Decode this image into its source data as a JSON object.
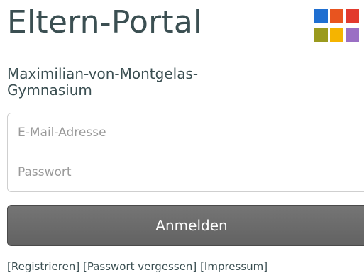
{
  "header": {
    "title": "Eltern-Portal",
    "logo": {
      "colors": [
        "#1f6fd1",
        "#e8541f",
        "#e23a2e",
        "#9a9a1e",
        "#f5b400",
        "#9a6fc4"
      ]
    }
  },
  "school": {
    "name": "Maximilian-von-Montgelas-Gymnasium"
  },
  "login_form": {
    "email": {
      "placeholder": "E-Mail-Adresse",
      "value": ""
    },
    "password": {
      "placeholder": "Passwort",
      "value": ""
    },
    "submit_label": "Anmelden"
  },
  "footer_links": [
    {
      "label": "[Registrieren]"
    },
    {
      "label": "[Passwort vergessen]"
    },
    {
      "label": "[Impressum]"
    }
  ]
}
